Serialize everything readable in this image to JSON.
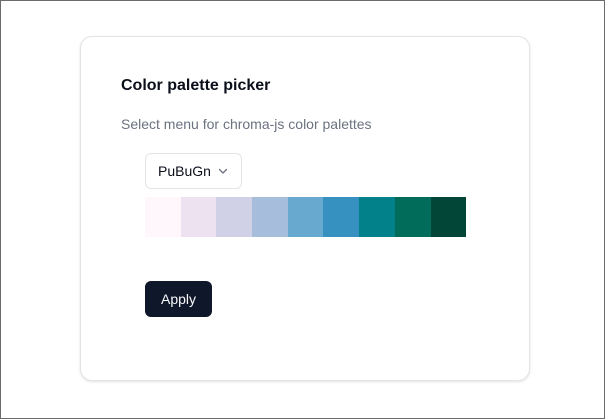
{
  "card": {
    "title": "Color palette picker",
    "subtitle": "Select menu for chroma-js color palettes"
  },
  "palette_select": {
    "selected": "PuBuGn",
    "icon": "chevron-down-icon"
  },
  "swatches": [
    "#fff7fb",
    "#ece2f0",
    "#d0d1e6",
    "#a6bddb",
    "#67a9cf",
    "#3690c0",
    "#02818a",
    "#016c59",
    "#014636"
  ],
  "apply_button": {
    "label": "Apply"
  }
}
